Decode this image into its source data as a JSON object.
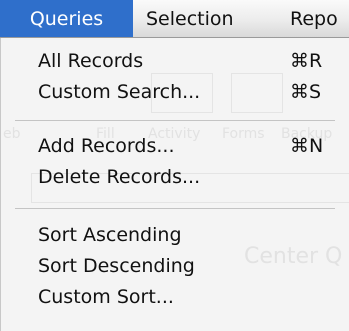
{
  "menubar": {
    "titles": [
      "Queries",
      "Selection",
      "Repo"
    ]
  },
  "queries_menu": {
    "groups": [
      [
        {
          "label": "All Records",
          "shortcut": "⌘R"
        },
        {
          "label": "Custom Search...",
          "shortcut": "⌘S"
        }
      ],
      [
        {
          "label": "Add Records...",
          "shortcut": "⌘N"
        },
        {
          "label": "Delete Records...",
          "shortcut": ""
        }
      ],
      [
        {
          "label": "Sort Ascending",
          "shortcut": ""
        },
        {
          "label": "Sort Descending",
          "shortcut": ""
        },
        {
          "label": "Custom Sort...",
          "shortcut": ""
        }
      ]
    ]
  },
  "background_window": {
    "toolbar_labels": [
      "eb",
      "Fill",
      "Activity",
      "Forms",
      "Backup"
    ],
    "fragment": "Center Q"
  }
}
